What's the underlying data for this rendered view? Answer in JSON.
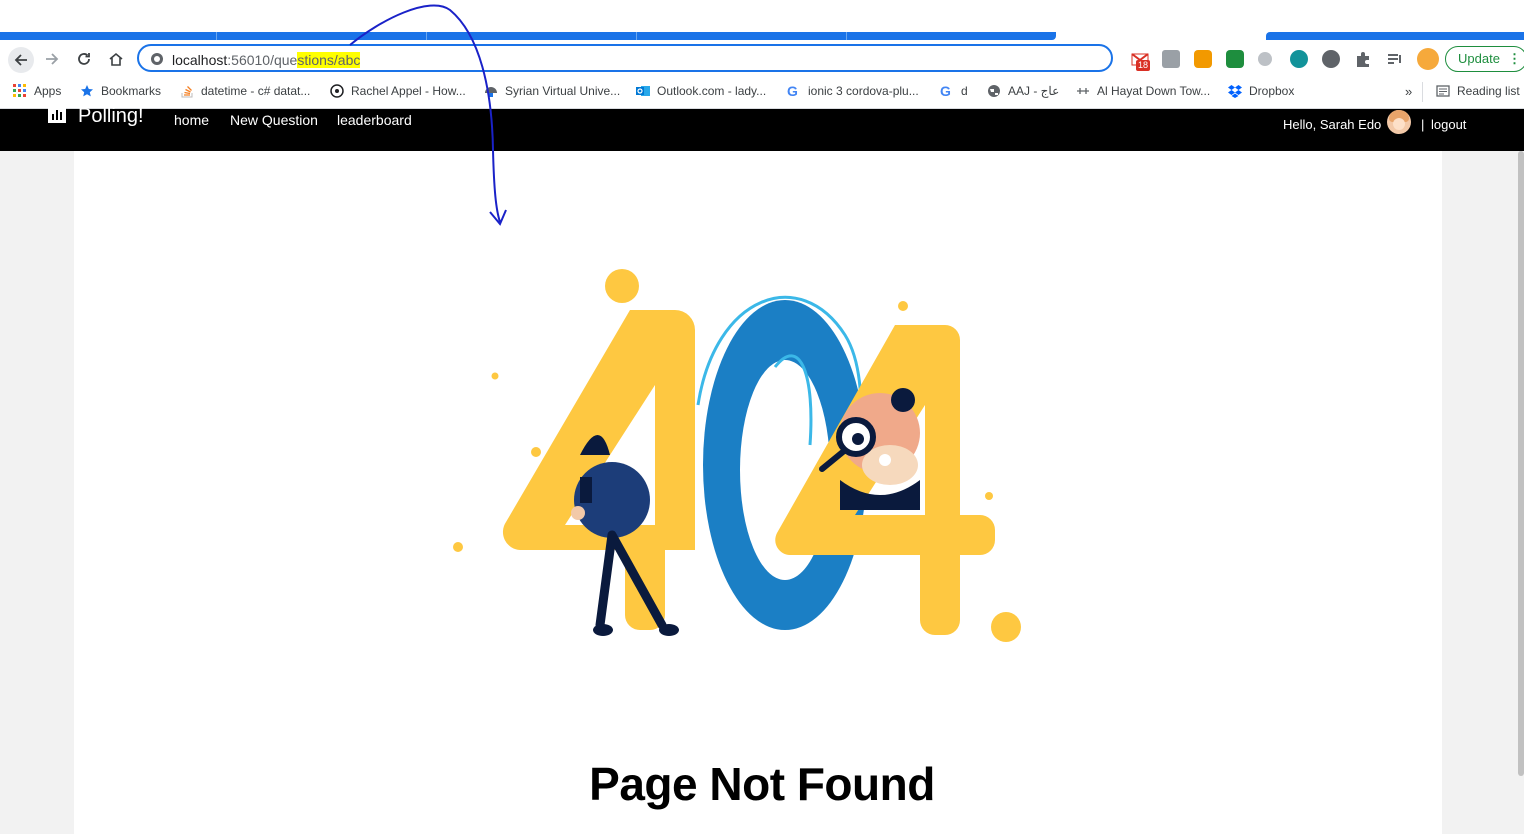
{
  "browser": {
    "url_host": "localhost",
    "url_port_path_plain": ":56010/que",
    "url_path_highlighted": "stions/abc",
    "badge_count": "18",
    "update_label": "Update",
    "bookmarks": [
      {
        "label": "Apps",
        "icon": "apps-grid-icon"
      },
      {
        "label": "Bookmarks",
        "icon": "star-icon"
      },
      {
        "label": "datetime - c# datat...",
        "icon": "stackoverflow-icon"
      },
      {
        "label": "Rachel Appel - How...",
        "icon": "rachel-appel-icon"
      },
      {
        "label": "Syrian Virtual Unive...",
        "icon": "svu-icon"
      },
      {
        "label": "Outlook.com - lady...",
        "icon": "outlook-icon"
      },
      {
        "label": "ionic 3 cordova-plu...",
        "icon": "google-icon"
      },
      {
        "label": "d",
        "icon": "google-icon"
      },
      {
        "label": "AAJ - عاج",
        "icon": "globe-icon"
      },
      {
        "label": "Al Hayat Down Tow...",
        "icon": "scale-icon"
      },
      {
        "label": "Dropbox",
        "icon": "dropbox-icon"
      }
    ],
    "overflow_label": "»",
    "reading_list_label": "Reading list"
  },
  "app": {
    "brand": "Polling!",
    "nav": {
      "home": "home",
      "new_question": "New Question",
      "leaderboard": "leaderboard"
    },
    "greeting": "Hello, Sarah Edo",
    "separator": "|",
    "logout": "logout"
  },
  "page": {
    "title": "Page Not Found",
    "illustration_number": "404"
  },
  "colors": {
    "accent_blue": "#1a73e8",
    "illustration_yellow": "#fec841",
    "illustration_blue": "#1b7fc5",
    "navbar_bg": "#000000"
  }
}
